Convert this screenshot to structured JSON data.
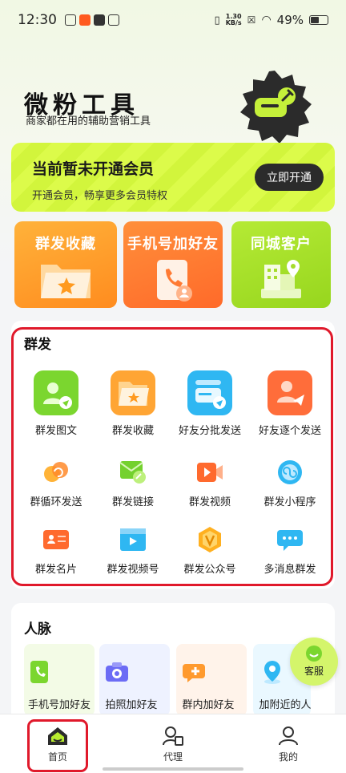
{
  "status": {
    "time": "12:30",
    "net_speed_top": "1.30",
    "net_speed_bottom": "KB/s",
    "battery": "49%"
  },
  "hero": {
    "title": "微粉工具",
    "subtitle": "商家都在用的辅助营销工具"
  },
  "vip": {
    "title": "当前暂未开通会员",
    "subtitle": "开通会员，畅享更多会员特权",
    "button": "立即开通"
  },
  "features": [
    {
      "label": "群发收藏",
      "color": "#ff9d2e"
    },
    {
      "label": "手机号加好友",
      "color": "#ff7a33"
    },
    {
      "label": "同城客户",
      "color": "#a7e02f"
    }
  ],
  "group_section": {
    "title": "群发",
    "items": [
      {
        "label": "群发图文",
        "icon": "image-text-icon"
      },
      {
        "label": "群发收藏",
        "icon": "folder-star-icon"
      },
      {
        "label": "好友分批发送",
        "icon": "batch-send-icon"
      },
      {
        "label": "好友逐个发送",
        "icon": "one-by-one-send-icon"
      },
      {
        "label": "群循环发送",
        "icon": "loop-send-icon"
      },
      {
        "label": "群发链接",
        "icon": "link-mail-icon"
      },
      {
        "label": "群发视频",
        "icon": "video-icon"
      },
      {
        "label": "群发小程序",
        "icon": "mini-program-icon"
      },
      {
        "label": "群发名片",
        "icon": "business-card-icon"
      },
      {
        "label": "群发视频号",
        "icon": "video-channel-icon"
      },
      {
        "label": "群发公众号",
        "icon": "official-account-icon"
      },
      {
        "label": "多消息群发",
        "icon": "multi-message-icon"
      }
    ]
  },
  "contacts_section": {
    "title": "人脉",
    "items": [
      {
        "label": "手机号加好友",
        "icon": "phone-book-icon"
      },
      {
        "label": "拍照加好友",
        "icon": "camera-icon"
      },
      {
        "label": "群内加好友",
        "icon": "group-add-icon"
      },
      {
        "label": "加附近的人",
        "icon": "location-pin-icon"
      }
    ]
  },
  "kefu": {
    "label": "客服"
  },
  "tabs": [
    {
      "label": "首页"
    },
    {
      "label": "代理"
    },
    {
      "label": "我的"
    }
  ]
}
